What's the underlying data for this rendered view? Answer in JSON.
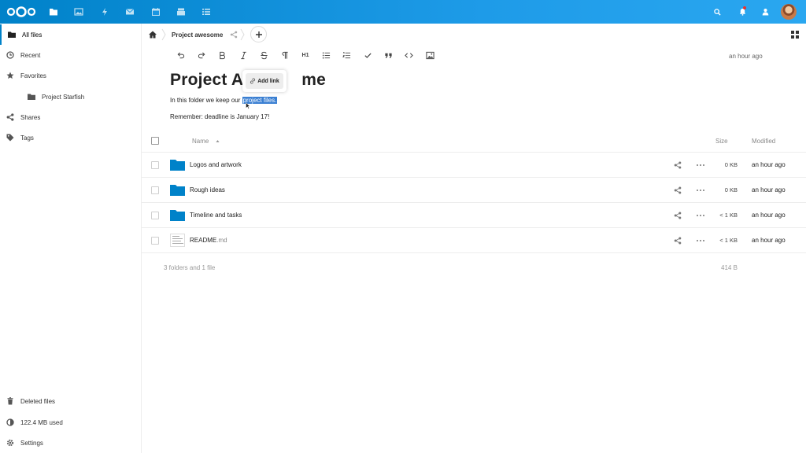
{
  "header": {
    "apps": [
      "files-icon",
      "photos-icon",
      "activity-icon",
      "mail-icon",
      "calendar-icon",
      "deck-icon",
      "tasks-icon"
    ],
    "right_icons": [
      "search-icon",
      "notifications-icon",
      "contacts-icon",
      "avatar"
    ],
    "accent": "#0082c9"
  },
  "sidebar": {
    "items": [
      {
        "label": "All files",
        "icon": "folder-icon"
      },
      {
        "label": "Recent",
        "icon": "clock-icon"
      },
      {
        "label": "Favorites",
        "icon": "star-icon"
      },
      {
        "label": "Project Starfish",
        "icon": "folder-icon"
      },
      {
        "label": "Shares",
        "icon": "share-icon"
      },
      {
        "label": "Tags",
        "icon": "tag-icon"
      }
    ],
    "bottom": [
      {
        "label": "Deleted files",
        "icon": "trash-icon"
      },
      {
        "label": "122.4 MB used",
        "icon": "quota-icon"
      },
      {
        "label": "Settings",
        "icon": "gear-icon"
      }
    ]
  },
  "controls": {
    "breadcrumb": "Project awesome"
  },
  "editor": {
    "toolbar_h1": "H1",
    "last_edit": "an hour ago",
    "title_part1": "Project A",
    "title_part2": "me",
    "line1_before": "In this folder we keep our ",
    "line1_selected": "project files.",
    "line2": "Remember: deadline is January 17!",
    "link_popup": "Add link"
  },
  "table": {
    "headers": {
      "name": "Name",
      "size": "Size",
      "modified": "Modified"
    },
    "rows": [
      {
        "name": "Logos and artwork",
        "ext": "",
        "size": "0 KB",
        "modified": "an hour ago",
        "type": "folder"
      },
      {
        "name": "Rough ideas",
        "ext": "",
        "size": "0 KB",
        "modified": "an hour ago",
        "type": "folder"
      },
      {
        "name": "Timeline and tasks",
        "ext": "",
        "size": "< 1 KB",
        "modified": "an hour ago",
        "type": "folder"
      },
      {
        "name": "README",
        "ext": ".md",
        "size": "< 1 KB",
        "modified": "an hour ago",
        "type": "file"
      }
    ],
    "summary": "3 folders and 1 file",
    "summary_size": "414 B"
  }
}
